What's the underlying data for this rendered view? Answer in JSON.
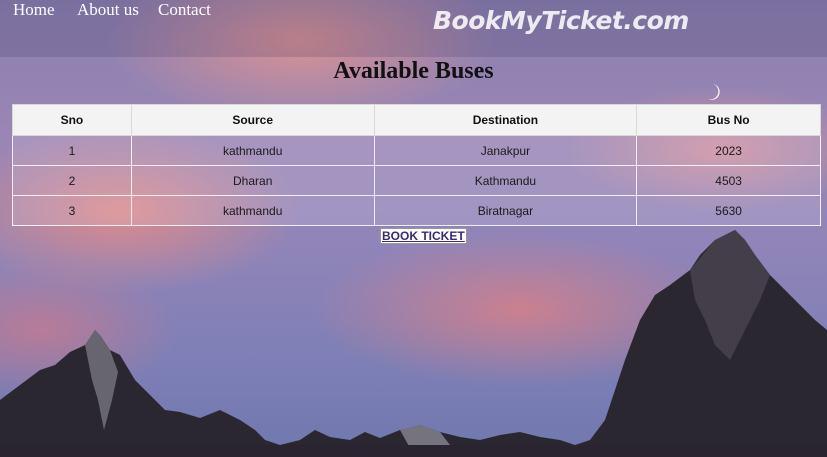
{
  "nav": {
    "home": "Home",
    "about": "About us",
    "contact": "Contact"
  },
  "brand": "BookMyTicket.com",
  "page_title": "Available Buses",
  "table": {
    "headers": [
      "Sno",
      "Source",
      "Destination",
      "Bus No"
    ],
    "rows": [
      [
        "1",
        "kathmandu",
        "Janakpur",
        "2023"
      ],
      [
        "2",
        "Dharan",
        "Kathmandu",
        "4503"
      ],
      [
        "3",
        "kathmandu",
        "Biratnagar",
        "5630"
      ]
    ]
  },
  "book_ticket": "BOOK TICKET"
}
